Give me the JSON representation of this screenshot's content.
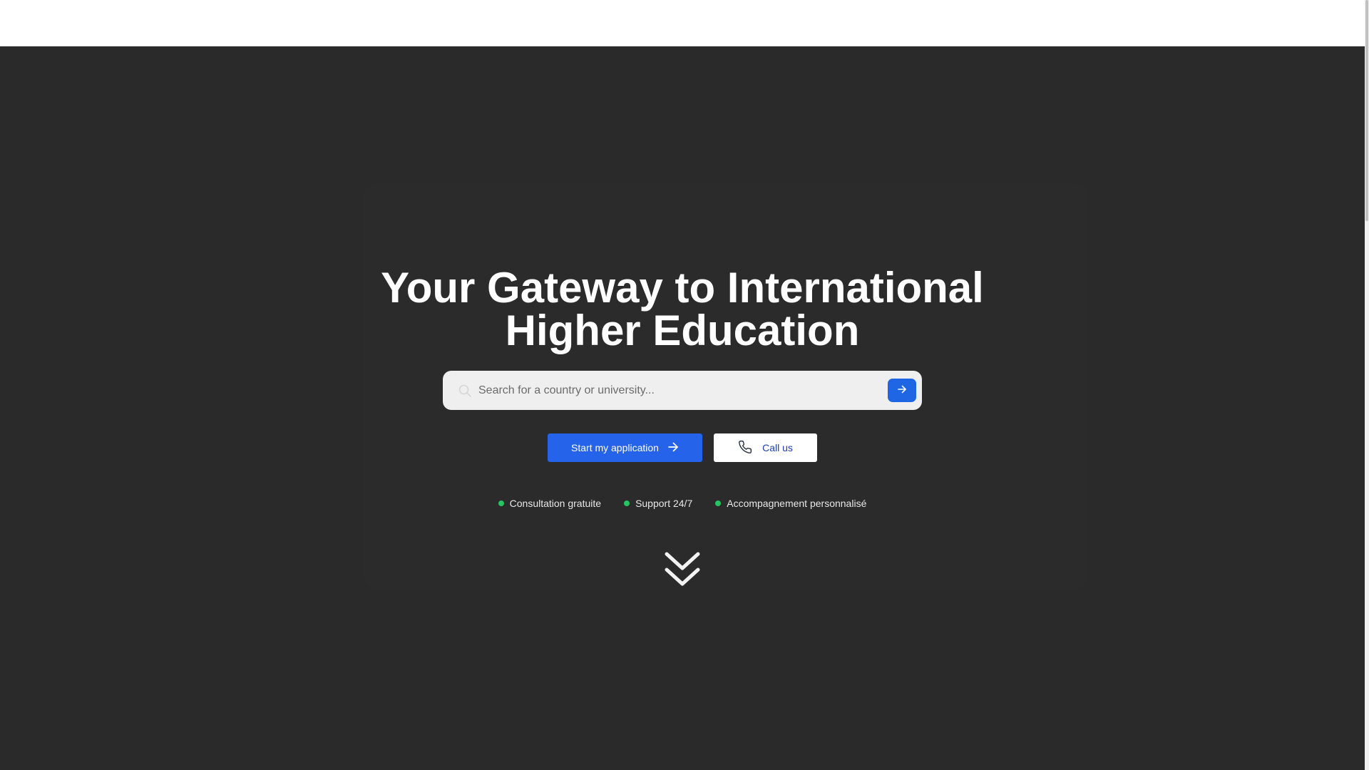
{
  "hero": {
    "title_line1": "Your Gateway to International",
    "title_line2": "Higher Education"
  },
  "search": {
    "placeholder": "Search for a country or university...",
    "value": "",
    "icon": "search-icon",
    "submit_icon": "arrow-right-icon"
  },
  "actions": {
    "primary_label": "Start my application",
    "primary_icon": "arrow-right-icon",
    "secondary_label": "Call us",
    "secondary_icon": "phone-icon"
  },
  "features": [
    {
      "label": "Consultation gratuite"
    },
    {
      "label": "Support 24/7"
    },
    {
      "label": "Accompagnement personnalisé"
    }
  ],
  "scroll_indicator": {
    "icon": "chevrons-down-icon"
  },
  "colors": {
    "hero_background": "#2a2a2a",
    "accent": "#2563eb",
    "feature_dot": "#22c55e",
    "secondary_text": "#1e40af"
  }
}
